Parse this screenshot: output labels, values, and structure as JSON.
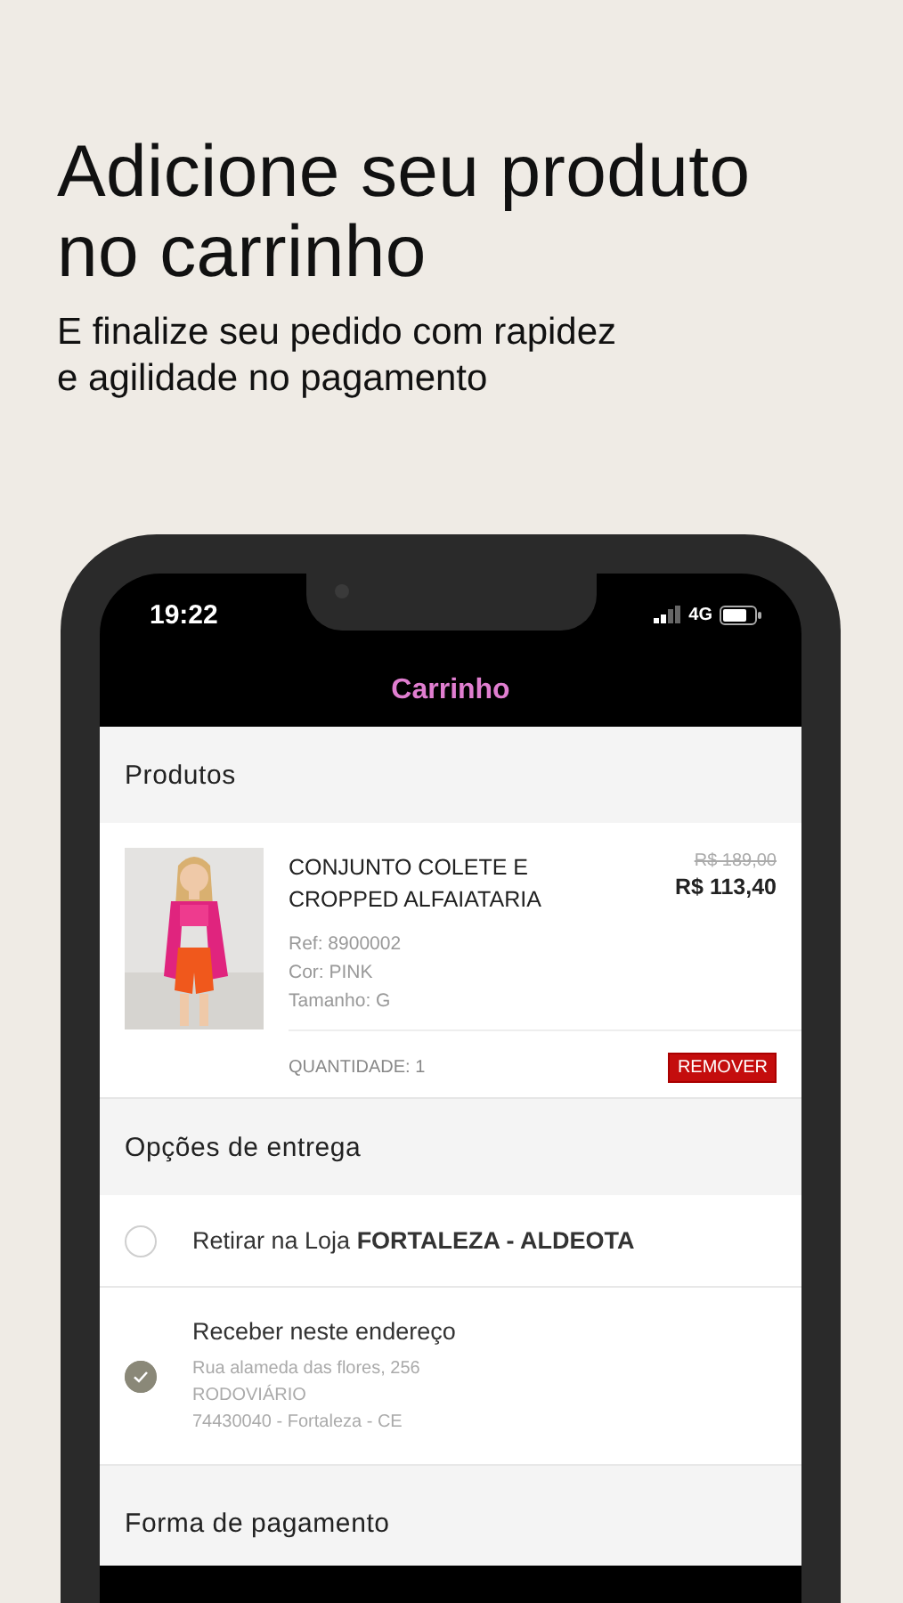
{
  "headline_lines": [
    "Adicione seu produto",
    "no carrinho"
  ],
  "subheadline_lines": [
    "E finalize seu pedido com rapidez",
    "e agilidade no pagamento"
  ],
  "status_bar": {
    "time": "19:22",
    "network": "4G"
  },
  "app_header": {
    "title": "Carrinho"
  },
  "products_section": {
    "title": "Produtos",
    "items": [
      {
        "name": "CONJUNTO COLETE E CROPPED ALFAIATARIA",
        "old_price": "R$ 189,00",
        "price": "R$ 113,40",
        "details": [
          "Ref: 8900002",
          "Cor: PINK",
          "Tamanho: G"
        ],
        "quantity": "QUANTIDADE: 1",
        "remove_label": "REMOVER"
      }
    ]
  },
  "delivery_section": {
    "title": "Opções de entrega",
    "options": [
      {
        "label": "Retirar na Loja **FORTALEZA - ALDEOTA**",
        "selected": false
      },
      {
        "label": "Receber neste endereço",
        "address": [
          "Rua alameda das flores, 256",
          "RODOVIÁRIO",
          "74430040 - Fortaleza - CE"
        ],
        "selected": true
      }
    ]
  },
  "payment_section": {
    "title": "Forma de pagamento"
  }
}
